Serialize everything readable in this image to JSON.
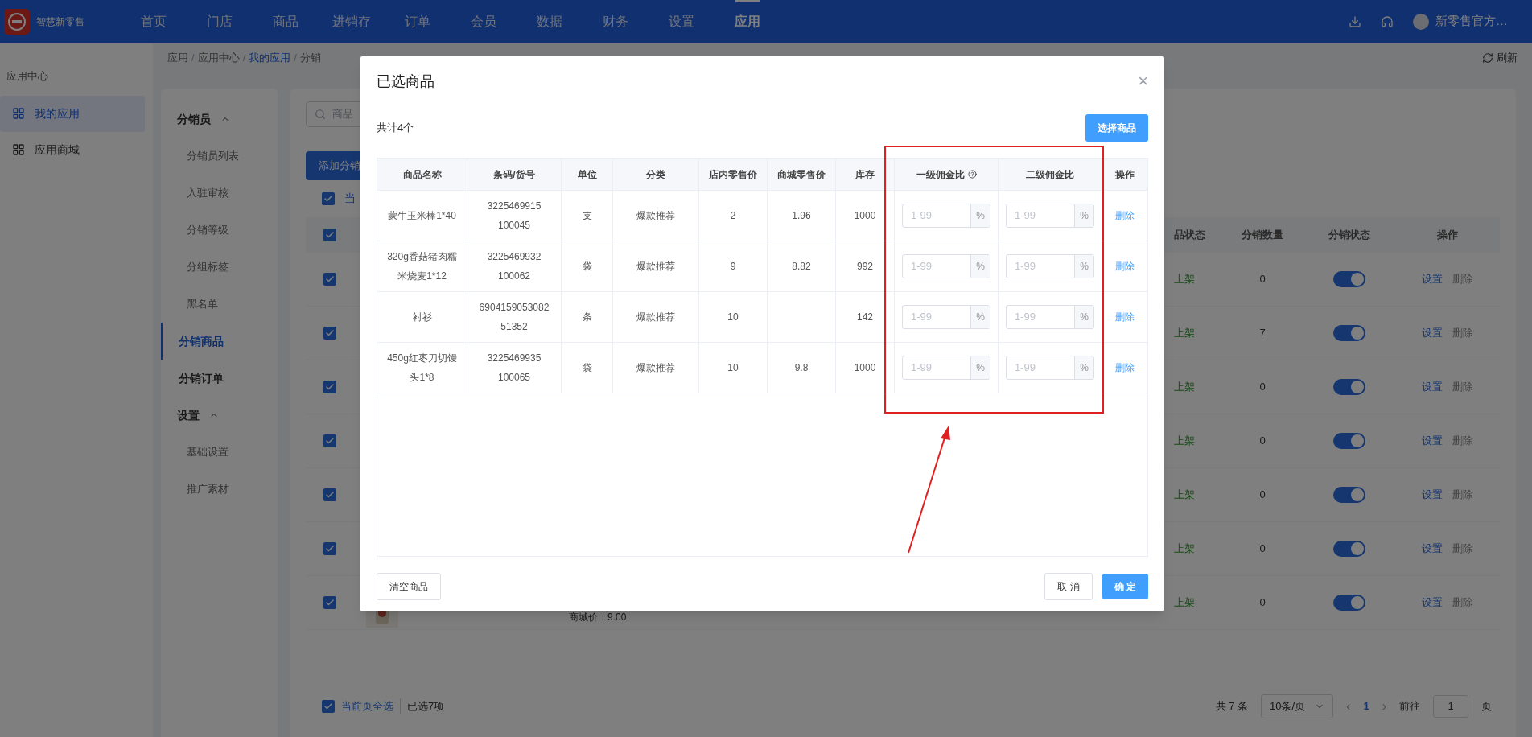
{
  "nav": {
    "brand": "智慧新零售",
    "items": [
      {
        "label": "首页",
        "selected": false
      },
      {
        "label": "门店",
        "selected": false
      },
      {
        "label": "商品",
        "selected": false
      },
      {
        "label": "进销存",
        "selected": false
      },
      {
        "label": "订单",
        "selected": false
      },
      {
        "label": "会员",
        "selected": false
      },
      {
        "label": "数据",
        "selected": false
      },
      {
        "label": "财务",
        "selected": false
      },
      {
        "label": "设置",
        "selected": false
      },
      {
        "label": "应用",
        "selected": true
      }
    ],
    "user": "新零售官方…"
  },
  "breadcrumb_separator": "/",
  "breadcrumb": [
    {
      "label": "应用",
      "current": false
    },
    {
      "label": "应用中心",
      "current": false
    },
    {
      "label": "我的应用",
      "current": true
    },
    {
      "label": "分销",
      "current": false
    }
  ],
  "refresh": "刷新",
  "sidebar": {
    "title": "应用中心",
    "items": [
      {
        "label": "我的应用",
        "selected": true
      },
      {
        "label": "应用商城",
        "selected": false
      }
    ]
  },
  "submenu": [
    {
      "kind": "group",
      "label": "分销员",
      "expanded": true,
      "children": [
        {
          "label": "分销员列表",
          "selected": false
        },
        {
          "label": "入驻审核",
          "selected": false
        },
        {
          "label": "分销等级",
          "selected": false
        },
        {
          "label": "分组标签",
          "selected": false
        },
        {
          "label": "黑名单",
          "selected": false
        }
      ]
    },
    {
      "kind": "item",
      "label": "分销商品",
      "selected": true
    },
    {
      "kind": "item",
      "label": "分销订单",
      "selected": false
    },
    {
      "kind": "group",
      "label": "设置",
      "expanded": true,
      "children": [
        {
          "label": "基础设置",
          "selected": false
        },
        {
          "label": "推广素材",
          "selected": false
        }
      ]
    }
  ],
  "content": {
    "search_placeholder": "商品",
    "add_button": "添加分销",
    "select_all_top": {
      "label": "当",
      "checked": true
    },
    "columns": [
      "品状态",
      "分销数量",
      "分销状态",
      "操作"
    ],
    "header_checked": true,
    "rows": [
      {
        "checked": true,
        "status": "上架",
        "count": "0",
        "on": true,
        "actions": [
          "设置",
          "删除"
        ]
      },
      {
        "checked": true,
        "status": "上架",
        "count": "7",
        "on": true,
        "actions": [
          "设置",
          "删除"
        ]
      },
      {
        "checked": true,
        "status": "上架",
        "count": "0",
        "on": true,
        "actions": [
          "设置",
          "删除"
        ]
      },
      {
        "checked": true,
        "status": "上架",
        "count": "0",
        "on": true,
        "actions": [
          "设置",
          "删除"
        ]
      },
      {
        "checked": true,
        "status": "上架",
        "count": "0",
        "on": true,
        "actions": [
          "设置",
          "删除"
        ]
      },
      {
        "checked": true,
        "status": "上架",
        "count": "0",
        "on": true,
        "actions": [
          "设置",
          "删除"
        ]
      },
      {
        "checked": true,
        "status": "上架",
        "count": "0",
        "on": true,
        "actions": [
          "设置",
          "删除"
        ],
        "price": "商城价：9.00"
      }
    ],
    "footer": {
      "select_all": {
        "label": "当前页全选",
        "checked": true
      },
      "selected_count": "已选7项",
      "total": "共 7 条",
      "page_size": "10条/页",
      "prev": "‹",
      "pages": [
        {
          "label": "1",
          "selected": true
        }
      ],
      "next": "›",
      "goto": "前往",
      "goto_value": "1",
      "page_unit": "页"
    }
  },
  "modal": {
    "title": "已选商品",
    "close": "×",
    "total": "共计4个",
    "select_button": "选择商品",
    "columns": [
      "商品名称",
      "条码/货号",
      "单位",
      "分类",
      "店内零售价",
      "商城零售价",
      "库存",
      "一级佣金比",
      "二级佣金比",
      "操作"
    ],
    "rows": [
      {
        "name": "蒙牛玉米棒1*40",
        "barcode": "3225469915 100045",
        "unit": "支",
        "category": "爆款推荐",
        "store_price": "2",
        "mall_price": "1.96",
        "stock": "1000",
        "rate1": {
          "placeholder": "1-99",
          "suffix": "%"
        },
        "rate2": {
          "placeholder": "1-99",
          "suffix": "%"
        },
        "action": "删除"
      },
      {
        "name": "320g香菇猪肉糯米烧麦1*12",
        "barcode": "3225469932 100062",
        "unit": "袋",
        "category": "爆款推荐",
        "store_price": "9",
        "mall_price": "8.82",
        "stock": "992",
        "rate1": {
          "placeholder": "1-99",
          "suffix": "%"
        },
        "rate2": {
          "placeholder": "1-99",
          "suffix": "%"
        },
        "action": "删除"
      },
      {
        "name": "衬衫",
        "barcode": "6904159053082 51352",
        "unit": "条",
        "category": "爆款推荐",
        "store_price": "10",
        "mall_price": "",
        "stock": "142",
        "rate1": {
          "placeholder": "1-99",
          "suffix": "%"
        },
        "rate2": {
          "placeholder": "1-99",
          "suffix": "%"
        },
        "action": "删除"
      },
      {
        "name": "450g红枣刀切馒头1*8",
        "barcode": "3225469935 100065",
        "unit": "袋",
        "category": "爆款推荐",
        "store_price": "10",
        "mall_price": "9.8",
        "stock": "1000",
        "rate1": {
          "placeholder": "1-99",
          "suffix": "%"
        },
        "rate2": {
          "placeholder": "1-99",
          "suffix": "%"
        },
        "action": "删除"
      }
    ],
    "clear_button": "清空商品",
    "cancel_button": "取 消",
    "confirm_button": "确 定"
  }
}
